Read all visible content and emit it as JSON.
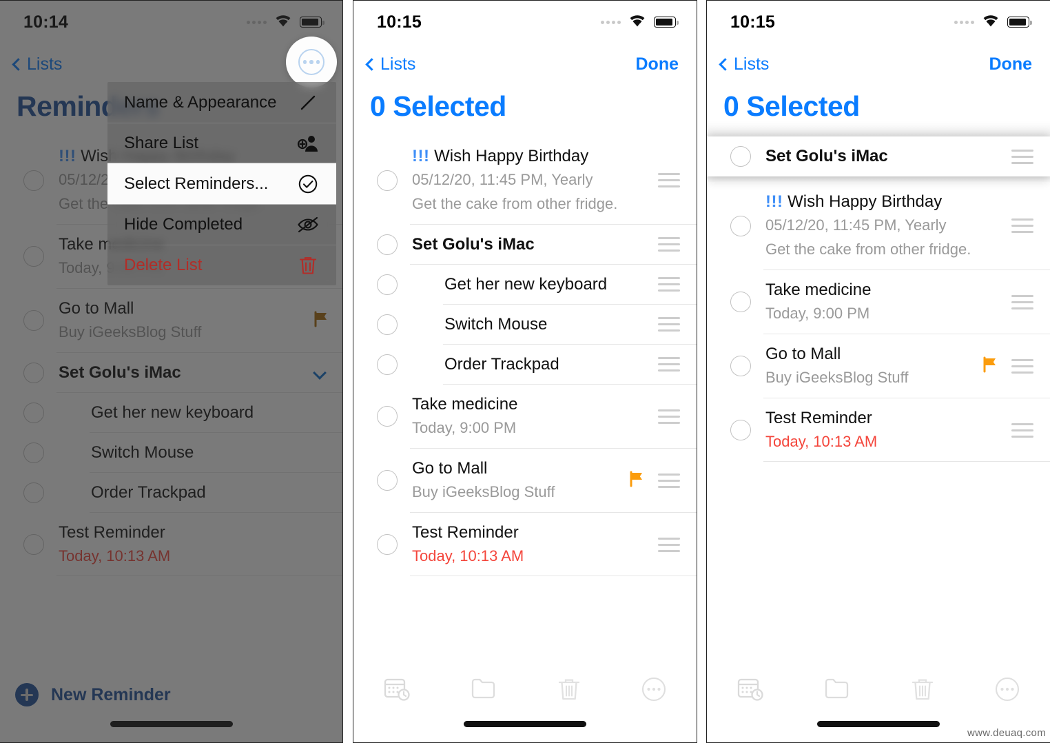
{
  "status_bar": {
    "time_left": "10:14",
    "time_middle": "10:15",
    "time_right": "10:15"
  },
  "colors": {
    "accent_blue": "#0a7cff",
    "navy": "#1d4f9c",
    "overdue_red": "#f4463c",
    "flag_orange": "#fb9c0c",
    "danger_red": "#b22d28"
  },
  "left_phone": {
    "nav": {
      "back_label": "Lists"
    },
    "title": "Reminders",
    "ellipsis_button": "more-options",
    "new_reminder_label": "New Reminder",
    "context_menu": [
      {
        "label": "Name & Appearance",
        "icon": "pencil-icon",
        "highlighted": false,
        "danger": false
      },
      {
        "label": "Share List",
        "icon": "share-person-icon",
        "highlighted": false,
        "danger": false
      },
      {
        "label": "Select Reminders...",
        "icon": "check-circle-icon",
        "highlighted": true,
        "danger": false
      },
      {
        "label": "Hide Completed",
        "icon": "eye-slash-icon",
        "highlighted": false,
        "danger": false
      },
      {
        "label": "Delete List",
        "icon": "trash-icon",
        "highlighted": false,
        "danger": true
      }
    ],
    "reminders": [
      {
        "bang": "!!!",
        "title": "Wish Happy Birthday",
        "sub": "05/12/20, 11:45 PM, Yearly",
        "note": "Get the cake from other fridge.",
        "indent": false,
        "bold": false,
        "flag": false,
        "overdue": false,
        "chevron": false
      },
      {
        "bang": "",
        "title": "Take medicine",
        "sub": "Today, 9:00 PM",
        "note": "",
        "indent": false,
        "bold": false,
        "flag": false,
        "overdue": false,
        "chevron": false
      },
      {
        "bang": "",
        "title": "Go to Mall",
        "sub": "Buy iGeeksBlog Stuff",
        "note": "",
        "indent": false,
        "bold": false,
        "flag": true,
        "overdue": false,
        "chevron": false
      },
      {
        "bang": "",
        "title": "Set Golu's iMac",
        "sub": "",
        "note": "",
        "indent": false,
        "bold": true,
        "flag": false,
        "overdue": false,
        "chevron": true
      },
      {
        "bang": "",
        "title": "Get her new keyboard",
        "sub": "",
        "note": "",
        "indent": true,
        "bold": false,
        "flag": false,
        "overdue": false,
        "chevron": false
      },
      {
        "bang": "",
        "title": "Switch Mouse",
        "sub": "",
        "note": "",
        "indent": true,
        "bold": false,
        "flag": false,
        "overdue": false,
        "chevron": false
      },
      {
        "bang": "",
        "title": "Order Trackpad",
        "sub": "",
        "note": "",
        "indent": true,
        "bold": false,
        "flag": false,
        "overdue": false,
        "chevron": false
      },
      {
        "bang": "",
        "title": "Test Reminder",
        "sub": "Today, 10:13 AM",
        "note": "",
        "indent": false,
        "bold": false,
        "flag": false,
        "overdue": true,
        "chevron": false
      }
    ]
  },
  "middle_phone": {
    "nav": {
      "back_label": "Lists",
      "done_label": "Done"
    },
    "title": "0 Selected",
    "reminders": [
      {
        "bang": "!!!",
        "title": "Wish Happy Birthday",
        "sub": "05/12/20, 11:45 PM, Yearly",
        "note": "Get the cake from other fridge.",
        "indent": false,
        "bold": false,
        "flag": false,
        "overdue": false
      },
      {
        "bang": "",
        "title": "Set Golu's iMac",
        "sub": "",
        "note": "",
        "indent": false,
        "bold": true,
        "flag": false,
        "overdue": false
      },
      {
        "bang": "",
        "title": "Get her new keyboard",
        "sub": "",
        "note": "",
        "indent": true,
        "bold": false,
        "flag": false,
        "overdue": false
      },
      {
        "bang": "",
        "title": "Switch Mouse",
        "sub": "",
        "note": "",
        "indent": true,
        "bold": false,
        "flag": false,
        "overdue": false
      },
      {
        "bang": "",
        "title": "Order Trackpad",
        "sub": "",
        "note": "",
        "indent": true,
        "bold": false,
        "flag": false,
        "overdue": false
      },
      {
        "bang": "",
        "title": "Take medicine",
        "sub": "Today, 9:00 PM",
        "note": "",
        "indent": false,
        "bold": false,
        "flag": false,
        "overdue": false
      },
      {
        "bang": "",
        "title": "Go to Mall",
        "sub": "Buy iGeeksBlog Stuff",
        "note": "",
        "indent": false,
        "bold": false,
        "flag": true,
        "overdue": false
      },
      {
        "bang": "",
        "title": "Test Reminder",
        "sub": "Today, 10:13 AM",
        "note": "",
        "indent": false,
        "bold": false,
        "flag": false,
        "overdue": true
      }
    ],
    "toolbar": [
      {
        "icon": "calendar-clock-icon"
      },
      {
        "icon": "folder-icon"
      },
      {
        "icon": "trash-icon"
      },
      {
        "icon": "ellipsis-circle-icon"
      }
    ]
  },
  "right_phone": {
    "nav": {
      "back_label": "Lists",
      "done_label": "Done"
    },
    "title": "0 Selected",
    "dragged_row": {
      "bang": "",
      "title": "Set Golu's iMac",
      "sub": "",
      "note": "",
      "indent": false,
      "bold": true,
      "flag": false,
      "overdue": false
    },
    "reminders": [
      {
        "bang": "!!!",
        "title": "Wish Happy Birthday",
        "sub": "05/12/20, 11:45 PM, Yearly",
        "note": "Get the cake from other fridge.",
        "indent": false,
        "bold": false,
        "flag": false,
        "overdue": false
      },
      {
        "bang": "",
        "title": "Take medicine",
        "sub": "Today, 9:00 PM",
        "note": "",
        "indent": false,
        "bold": false,
        "flag": false,
        "overdue": false
      },
      {
        "bang": "",
        "title": "Go to Mall",
        "sub": "Buy iGeeksBlog Stuff",
        "note": "",
        "indent": false,
        "bold": false,
        "flag": true,
        "overdue": false
      },
      {
        "bang": "",
        "title": "Test Reminder",
        "sub": "Today, 10:13 AM",
        "note": "",
        "indent": false,
        "bold": false,
        "flag": false,
        "overdue": true
      }
    ],
    "toolbar": [
      {
        "icon": "calendar-clock-icon"
      },
      {
        "icon": "folder-icon"
      },
      {
        "icon": "trash-icon"
      },
      {
        "icon": "ellipsis-circle-icon"
      }
    ]
  },
  "watermark": "www.deuaq.com"
}
